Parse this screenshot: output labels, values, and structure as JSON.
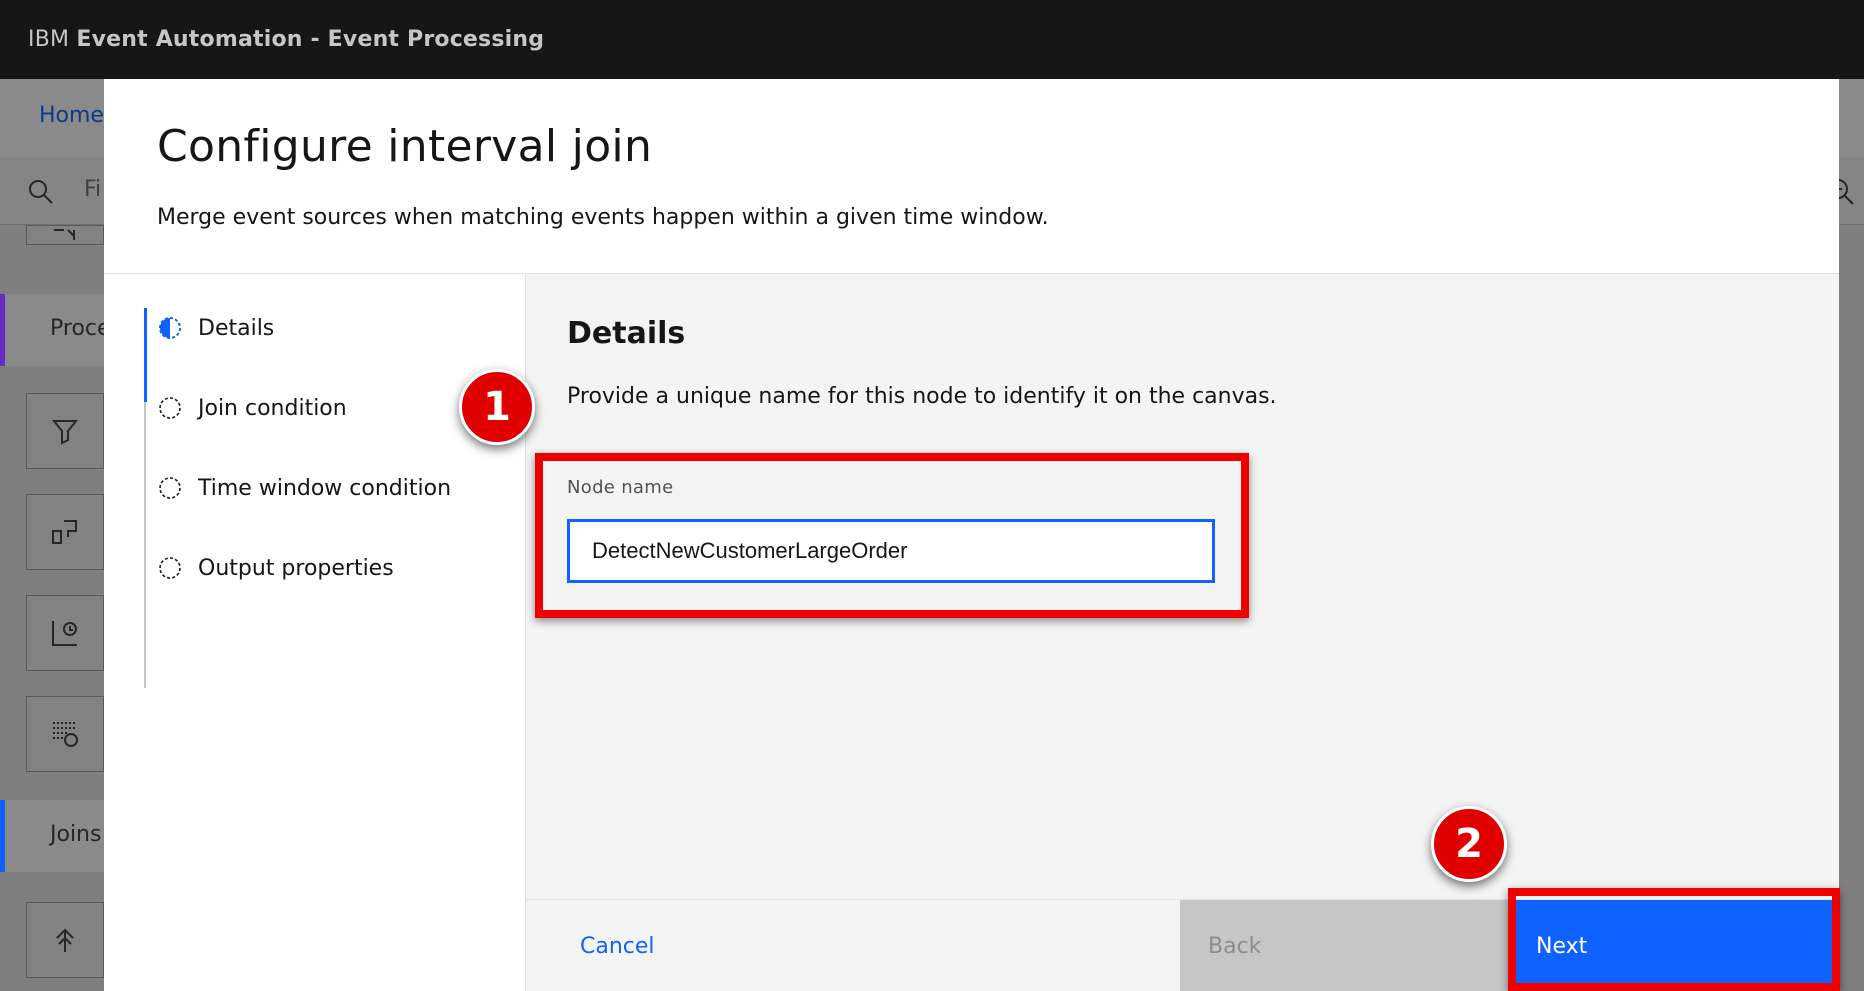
{
  "app": {
    "brand_ibm": "IBM",
    "brand_product": "Event Automation - Event Processing"
  },
  "background": {
    "breadcrumb": "Home",
    "search_placeholder_fragment": "Fi",
    "palette_categories": [
      {
        "label": "Proce",
        "color": "#6929c4"
      },
      {
        "label": "Joins",
        "color": "#0f62fe"
      }
    ],
    "palette_icons": [
      "source-icon",
      "filter-icon",
      "transform-icon",
      "aggregate-icon",
      "window-icon",
      "join-icon"
    ]
  },
  "modal": {
    "title": "Configure interval join",
    "description": "Merge event sources when matching events happen within a given time window.",
    "steps": [
      {
        "label": "Details",
        "state": "current"
      },
      {
        "label": "Join condition",
        "state": "incomplete"
      },
      {
        "label": "Time window condition",
        "state": "incomplete"
      },
      {
        "label": "Output properties",
        "state": "incomplete"
      }
    ],
    "section_title": "Details",
    "section_help": "Provide a unique name for this node to identify it on the canvas.",
    "node_name_label": "Node name",
    "node_name_value": "DetectNewCustomerLargeOrder",
    "buttons": {
      "cancel": "Cancel",
      "back": "Back",
      "next": "Next"
    }
  },
  "annotations": {
    "badge_1": "1",
    "badge_2": "2",
    "highlight_color": "#ee0000"
  },
  "colors": {
    "accent": "#0f62fe",
    "header_bg": "#161616"
  }
}
